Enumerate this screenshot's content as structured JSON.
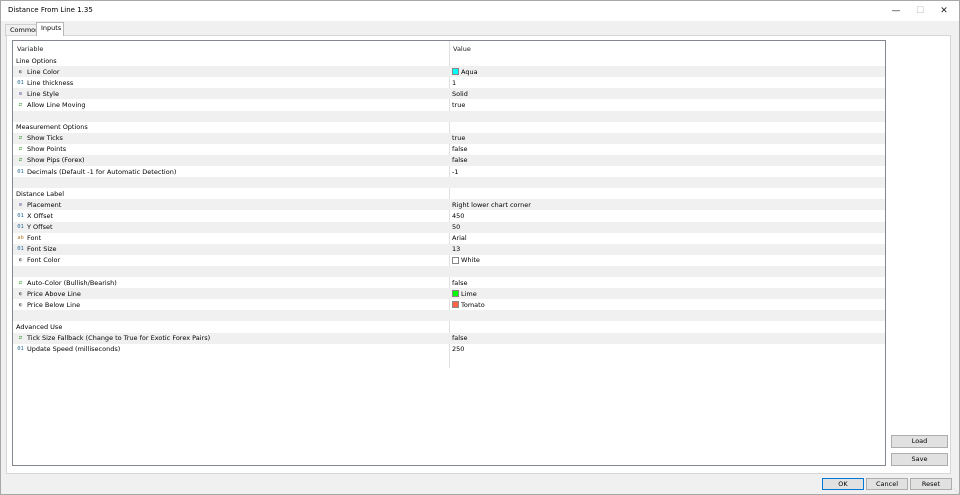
{
  "window": {
    "title": "Distance From Line 1.35"
  },
  "tabs": [
    {
      "label": "Common"
    },
    {
      "label": "Inputs"
    }
  ],
  "grid": {
    "columns": {
      "variable": "Variable",
      "value": "Value"
    },
    "rows": [
      {
        "type": "section",
        "label": "Line Options"
      },
      {
        "icon": "color",
        "label": "Line Color",
        "value": "Aqua",
        "swatch": "#00ffff"
      },
      {
        "icon": "int",
        "label": "Line thickness",
        "value": "1"
      },
      {
        "icon": "enum",
        "label": "Line Style",
        "value": "Solid"
      },
      {
        "icon": "bool",
        "label": "Allow Line Moving",
        "value": "true"
      },
      {
        "type": "blank"
      },
      {
        "type": "section",
        "label": "Measurement Options"
      },
      {
        "icon": "bool",
        "label": "Show Ticks",
        "value": "true"
      },
      {
        "icon": "bool",
        "label": "Show Points",
        "value": "false"
      },
      {
        "icon": "bool",
        "label": "Show Pips (Forex)",
        "value": "false"
      },
      {
        "icon": "int",
        "label": "Decimals (Default -1 for Automatic Detection)",
        "value": "-1"
      },
      {
        "type": "blank"
      },
      {
        "type": "section",
        "label": "Distance Label"
      },
      {
        "icon": "enum",
        "label": "Placement",
        "value": "Right lower chart corner"
      },
      {
        "icon": "int",
        "label": "X Offset",
        "value": "450"
      },
      {
        "icon": "int",
        "label": "Y Offset",
        "value": "50"
      },
      {
        "icon": "str",
        "label": "Font",
        "value": "Arial"
      },
      {
        "icon": "int",
        "label": "Font Size",
        "value": "13"
      },
      {
        "icon": "color",
        "label": "Font Color",
        "value": "White",
        "swatch": "#ffffff"
      },
      {
        "type": "blank"
      },
      {
        "icon": "bool",
        "label": "Auto-Color (Bullish/Bearish)",
        "value": "false"
      },
      {
        "icon": "color",
        "label": "Price Above Line",
        "value": "Lime",
        "swatch": "#00ff00"
      },
      {
        "icon": "color",
        "label": "Price Below Line",
        "value": "Tomato",
        "swatch": "#ff6347"
      },
      {
        "type": "blank"
      },
      {
        "type": "section",
        "label": "Advanced Use"
      },
      {
        "icon": "bool",
        "label": "Tick Size Fallback (Change to True for Exotic Forex Pairs)",
        "value": "false"
      },
      {
        "icon": "int",
        "label": "Update Speed (milliseconds)",
        "value": "250"
      }
    ]
  },
  "side_buttons": {
    "load": "Load",
    "save": "Save"
  },
  "bottom_buttons": {
    "ok": "OK",
    "cancel": "Cancel",
    "reset": "Reset"
  }
}
